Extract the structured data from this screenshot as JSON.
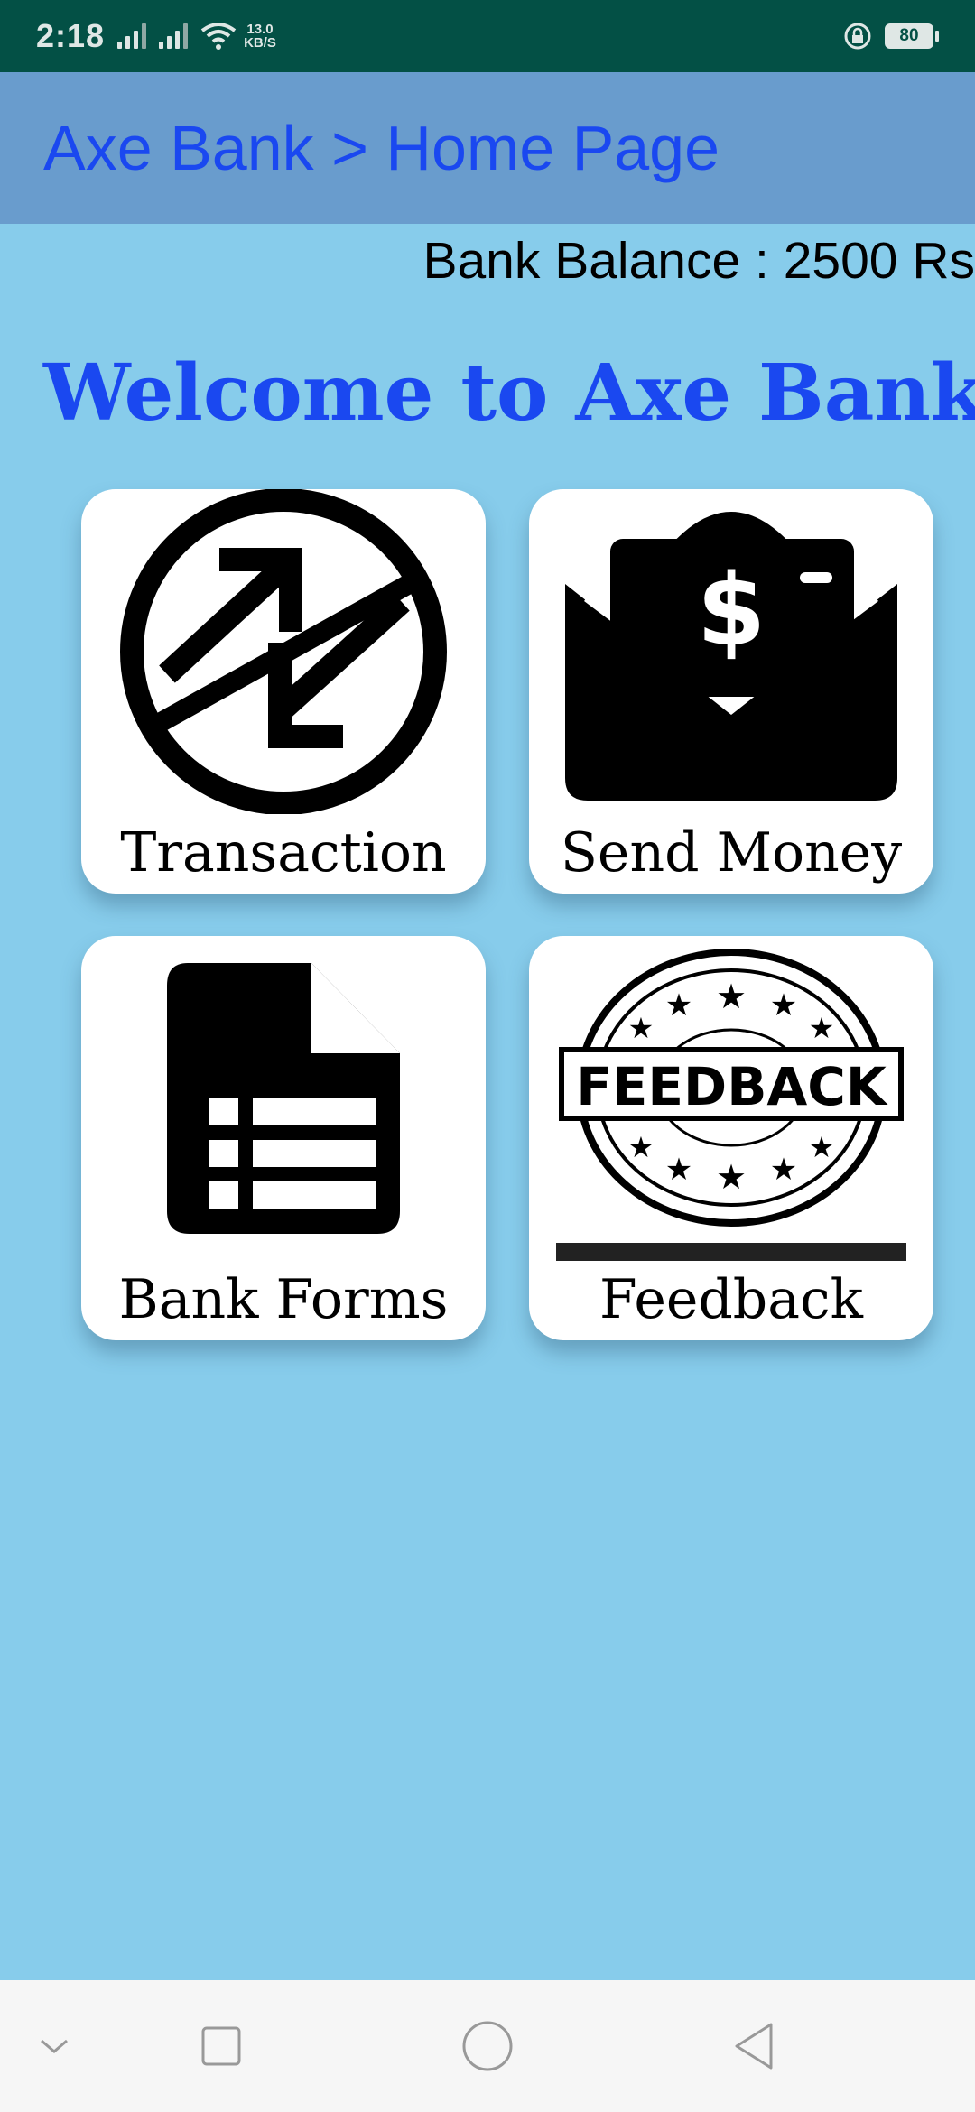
{
  "status_bar": {
    "time": "2:18",
    "network_speed_value": "13.0",
    "network_speed_unit": "KB/S",
    "battery_level": "80",
    "icons": [
      "signal-icon",
      "signal-icon",
      "wifi-icon",
      "rotation-lock-icon",
      "battery-icon"
    ]
  },
  "app_bar": {
    "title": "Axe Bank > Home Page"
  },
  "balance": {
    "text": "Bank Balance : 2500 Rs"
  },
  "welcome": {
    "text": "Welcome to Axe Bank"
  },
  "menu": {
    "items": [
      {
        "label": "Transaction",
        "icon": "transaction-arrows-icon"
      },
      {
        "label": "Send Money",
        "icon": "money-envelope-icon"
      },
      {
        "label": "Bank Forms",
        "icon": "form-document-icon"
      },
      {
        "label": "Feedback",
        "icon": "feedback-stamp-icon"
      }
    ]
  },
  "nav_bar": {
    "buttons": [
      "hide-nav-icon",
      "recents-icon",
      "home-icon",
      "back-icon"
    ]
  },
  "colors": {
    "status_bar": "#035045",
    "app_bar": "#699ccd",
    "background": "#87cceb",
    "accent_text": "#1a48f0",
    "card": "#ffffff"
  }
}
